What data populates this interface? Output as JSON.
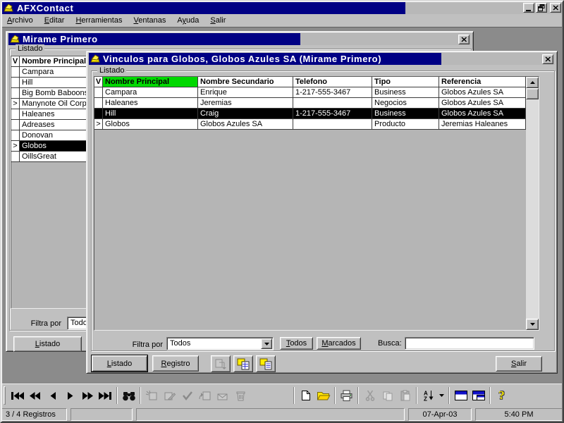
{
  "app": {
    "title": "AFXContact"
  },
  "menu": {
    "items": [
      {
        "id": "archivo",
        "pre": "",
        "key": "A",
        "rest": "rchivo"
      },
      {
        "id": "editar",
        "pre": "",
        "key": "E",
        "rest": "ditar"
      },
      {
        "id": "herramientas",
        "pre": "",
        "key": "H",
        "rest": "erramientas"
      },
      {
        "id": "ventanas",
        "pre": "",
        "key": "V",
        "rest": "entanas"
      },
      {
        "id": "ayuda",
        "pre": "A",
        "key": "y",
        "rest": "uda"
      },
      {
        "id": "salir",
        "pre": "",
        "key": "S",
        "rest": "alir"
      }
    ]
  },
  "window_mirame": {
    "title": "Mirame Primero",
    "group_label": "Listado",
    "table": {
      "headers": [
        "V",
        "Nombre Principal"
      ],
      "rows": [
        {
          "marker": "",
          "name": "Campara"
        },
        {
          "marker": "",
          "name": "Hill"
        },
        {
          "marker": "",
          "name": "Big Bomb Baboons"
        },
        {
          "marker": ">",
          "name": "Manynote Oil Corp."
        },
        {
          "marker": "",
          "name": "Haleanes"
        },
        {
          "marker": "",
          "name": "Adreases"
        },
        {
          "marker": "",
          "name": "Donovan"
        },
        {
          "marker": ">",
          "name": "Globos"
        },
        {
          "marker": "",
          "name": "OillsGreat"
        }
      ],
      "selected_row": 7
    },
    "filter_label": "Filtra por",
    "filter_value": "Todos",
    "buttons": {
      "listado": {
        "key": "L",
        "rest": "istado"
      },
      "registro": {
        "key": "R",
        "rest": "egistro"
      }
    }
  },
  "window_vinculos": {
    "title": "Vinculos para Globos, Globos Azules SA (Mirame Primero)",
    "group_label": "Listado",
    "table": {
      "headers": [
        "V",
        "Nombre Principal",
        "Nombre Secundario",
        "Telefono",
        "Tipo",
        "Referencia"
      ],
      "highlight_col": 1,
      "rows": [
        [
          "",
          "Campara",
          "Enrique",
          "1-217-555-3467",
          "Business",
          "Globos Azules SA"
        ],
        [
          "",
          "Haleanes",
          "Jeremias",
          "",
          "Negocios",
          "Globos Azules SA"
        ],
        [
          "",
          "Hill",
          "Craig",
          "1-217-555-3467",
          "Business",
          "Globos Azules SA"
        ],
        [
          ">",
          "Globos",
          "Globos Azules SA",
          "",
          "Producto",
          "Jeremias Haleanes"
        ]
      ],
      "selected_row": 2
    },
    "filter_label": "Filtra por",
    "filter_value": "Todos",
    "busca_label": "Busca:",
    "busca_value": "",
    "buttons": {
      "todos": {
        "key": "T",
        "rest": "odos"
      },
      "marcados": {
        "key": "M",
        "rest": "arcados"
      },
      "listado": {
        "key": "L",
        "rest": "istado"
      },
      "registro": {
        "key": "R",
        "rest": "egistro"
      },
      "salir": {
        "key": "S",
        "rest": "alir"
      }
    }
  },
  "toolbar": {
    "items": [
      "nav-first",
      "nav-prev-page",
      "nav-prev",
      "nav-next",
      "nav-next-page",
      "nav-last",
      "|",
      "search",
      "|",
      "note-new",
      "note-edit",
      "confirm-check",
      "note-revert",
      "note-send",
      "delete-trash",
      "gap",
      "|",
      "file-new",
      "folder-open",
      "|",
      "print",
      "|",
      "cut",
      "copy",
      "paste",
      "|",
      "sort-az",
      "sort-menu",
      "|",
      "window-list",
      "window-form",
      "|",
      "help"
    ]
  },
  "statusbar": {
    "records": "3 / 4 Registros",
    "date": "07-Apr-03",
    "time": "5:40 PM"
  },
  "colors": {
    "titlebar": "#000084",
    "titlebar_end": "#b8b8b8",
    "green": "#00d800",
    "mdi": "#8b8b8b",
    "selected_bg": "#000000",
    "selected_fg": "#ffffff"
  }
}
